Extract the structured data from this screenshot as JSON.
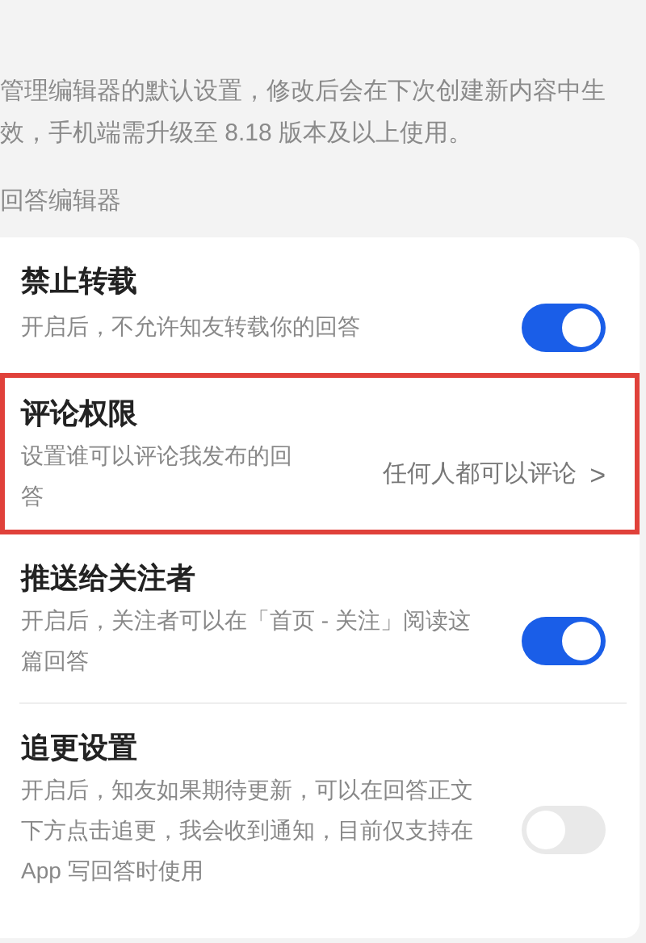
{
  "intro": [
    "管理编辑器的默认设置，修改后会在下次创建新内容中生",
    "效，手机端需升级至 8.18 版本及以上使用。"
  ],
  "section_title": "回答编辑器",
  "settings": [
    {
      "kind": "toggle",
      "title": "禁止转载",
      "description": "开启后，不允许知友转载你的回答",
      "on": true,
      "highlighted": false
    },
    {
      "kind": "link",
      "title": "评论权限",
      "description": "设置谁可以评论我发布的回答",
      "value": "任何人都可以评论",
      "chevron": ">",
      "highlighted": true
    },
    {
      "kind": "toggle",
      "title": "推送给关注者",
      "description": "开启后，关注者可以在「首页 - 关注」阅读这篇回答",
      "on": true,
      "highlighted": false
    },
    {
      "kind": "toggle",
      "title": "追更设置",
      "description": "开启后，知友如果期待更新，可以在回答正文下方点击追更，我会收到通知，目前仅支持在 App 写回答时使用",
      "on": false,
      "highlighted": false
    }
  ]
}
